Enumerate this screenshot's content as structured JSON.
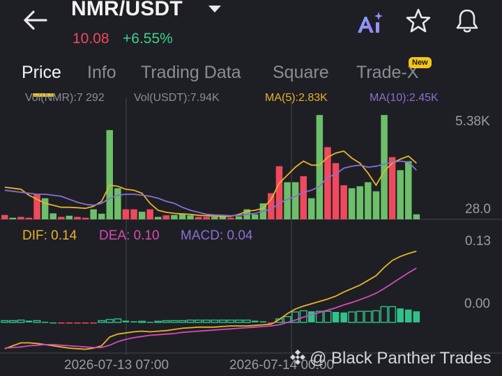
{
  "header": {
    "pair": "NMR/USDT",
    "price": "10.08",
    "change": "+6.55%",
    "price_color": "#f0485d",
    "change_color": "#3ecf8e",
    "icons": [
      "back-arrow-icon",
      "dropdown-caret-icon",
      "ai-icon",
      "star-icon",
      "bell-icon"
    ]
  },
  "tabs": [
    {
      "label": "Price",
      "active": true
    },
    {
      "label": "Info",
      "active": false
    },
    {
      "label": "Trading Data",
      "active": false
    },
    {
      "label": "Square",
      "active": false
    },
    {
      "label": "Trade-X",
      "active": false,
      "badge": "New"
    }
  ],
  "chart": {
    "volume_legend_cut": [
      "Vol(NMR):7 292",
      "Vol(USDT):7.94K",
      "MA(5):2.83K",
      "MA(10):2.45K"
    ],
    "volume_axis": {
      "top": "5.38K",
      "bottom": "28.0"
    },
    "macd_legend": {
      "dif": "DIF: 0.14",
      "dea": "DEA: 0.10",
      "macd": "MACD: 0.04"
    },
    "macd_axis": {
      "top": "0.13",
      "zero": "0.00"
    },
    "time_labels": [
      "2026-07-13 07:00",
      "2026-07-14 00:00"
    ],
    "watermark": "@ Black Panther Trades",
    "colors": {
      "up": "#6dbf6a",
      "down": "#f0485d",
      "ma5": "#e8b32a",
      "ma10": "#8a6fd1",
      "dif": "#e8b32a",
      "dea": "#d64bb5",
      "macd_hist": "#2fc28a",
      "grid": "#44464f"
    }
  },
  "chart_data": [
    {
      "type": "bar",
      "title": "",
      "ylim": [
        28.0,
        5380
      ],
      "series": [
        {
          "name": "Vol",
          "values": [
            220,
            80,
            120,
            80,
            1250,
            1050,
            300,
            120,
            180,
            120,
            80,
            500,
            280,
            4450,
            1550,
            500,
            500,
            380,
            500,
            120,
            200,
            220,
            250,
            200,
            120,
            120,
            120,
            150,
            80,
            150,
            500,
            250,
            800,
            1300,
            2650,
            1850,
            1850,
            2150,
            1050,
            5200,
            3600,
            2800,
            1700,
            1550,
            1650,
            1850,
            1400,
            5200,
            3100,
            2450,
            2900,
            250
          ]
        },
        {
          "name": "MA(5)",
          "values": [
            1600,
            1550,
            1500,
            1200,
            1000,
            800,
            700,
            600,
            600,
            580,
            550,
            650,
            900,
            1700,
            1650,
            1500,
            1450,
            1300,
            800,
            450,
            350,
            300,
            270,
            250,
            200,
            180,
            160,
            150,
            150,
            250,
            400,
            450,
            550,
            1000,
            1800,
            2200,
            2600,
            2900,
            2700,
            2700,
            3100,
            3300,
            3400,
            3050,
            2800,
            2300,
            1700,
            2400,
            2800,
            3000,
            3150,
            2800
          ]
        },
        {
          "name": "MA(10)",
          "values": [
            1450,
            1400,
            1350,
            1300,
            1250,
            1250,
            1200,
            1150,
            1000,
            850,
            750,
            700,
            800,
            1050,
            1200,
            1250,
            1250,
            1200,
            1150,
            1050,
            900,
            800,
            600,
            450,
            350,
            250,
            220,
            200,
            180,
            200,
            250,
            300,
            400,
            500,
            800,
            1000,
            1150,
            1350,
            1450,
            1650,
            2100,
            2250,
            2550,
            2650,
            2700,
            2600,
            2650,
            2750,
            2850,
            2900,
            2850,
            2450
          ]
        }
      ],
      "up_flags": [
        false,
        true,
        false,
        false,
        false,
        true,
        true,
        false,
        true,
        false,
        false,
        true,
        true,
        true,
        true,
        false,
        false,
        true,
        false,
        true,
        false,
        true,
        true,
        true,
        false,
        false,
        true,
        true,
        false,
        true,
        true,
        true,
        true,
        false,
        false,
        true,
        true,
        false,
        true,
        true,
        false,
        false,
        false,
        true,
        true,
        true,
        true,
        true,
        false,
        true,
        true,
        true
      ]
    },
    {
      "type": "line",
      "title": "",
      "ylim": [
        -0.05,
        0.13
      ],
      "series": [
        {
          "name": "DIF",
          "values": [
            -0.045,
            -0.04,
            -0.035,
            -0.035,
            -0.036,
            -0.038,
            -0.04,
            -0.042,
            -0.044,
            -0.045,
            -0.046,
            -0.044,
            -0.04,
            -0.025,
            -0.02,
            -0.018,
            -0.016,
            -0.015,
            -0.016,
            -0.015,
            -0.014,
            -0.012,
            -0.01,
            -0.009,
            -0.008,
            -0.008,
            -0.008,
            -0.007,
            -0.006,
            -0.006,
            -0.006,
            -0.005,
            -0.004,
            -0.003,
            0.005,
            0.015,
            0.023,
            0.028,
            0.032,
            0.036,
            0.04,
            0.045,
            0.052,
            0.058,
            0.064,
            0.072,
            0.08,
            0.094,
            0.106,
            0.113,
            0.118,
            0.122
          ]
        },
        {
          "name": "DEA",
          "values": [
            -0.044,
            -0.043,
            -0.042,
            -0.04,
            -0.039,
            -0.038,
            -0.038,
            -0.039,
            -0.04,
            -0.041,
            -0.042,
            -0.043,
            -0.043,
            -0.039,
            -0.033,
            -0.029,
            -0.026,
            -0.024,
            -0.022,
            -0.021,
            -0.02,
            -0.019,
            -0.017,
            -0.016,
            -0.015,
            -0.014,
            -0.013,
            -0.012,
            -0.011,
            -0.01,
            -0.009,
            -0.008,
            -0.007,
            -0.006,
            -0.004,
            0.0,
            0.004,
            0.009,
            0.013,
            0.017,
            0.021,
            0.025,
            0.03,
            0.034,
            0.039,
            0.044,
            0.05,
            0.058,
            0.067,
            0.076,
            0.085,
            0.093
          ]
        },
        {
          "name": "MACD",
          "values": [
            0.003,
            0.003,
            0.004,
            0.003,
            0.003,
            0.001,
            0.0,
            -0.001,
            -0.001,
            -0.001,
            -0.001,
            -0.001,
            0.003,
            0.005,
            0.006,
            0.003,
            0.002,
            0.002,
            0.001,
            0.002,
            0.003,
            0.003,
            0.003,
            0.004,
            0.004,
            0.004,
            0.004,
            0.004,
            0.004,
            0.004,
            0.004,
            0.003,
            0.002,
            -0.002,
            0.006,
            0.01,
            0.018,
            0.02,
            0.019,
            0.019,
            0.019,
            0.018,
            0.017,
            0.018,
            0.019,
            0.019,
            0.02,
            0.027,
            0.027,
            0.024,
            0.022,
            0.019
          ]
        }
      ]
    }
  ]
}
